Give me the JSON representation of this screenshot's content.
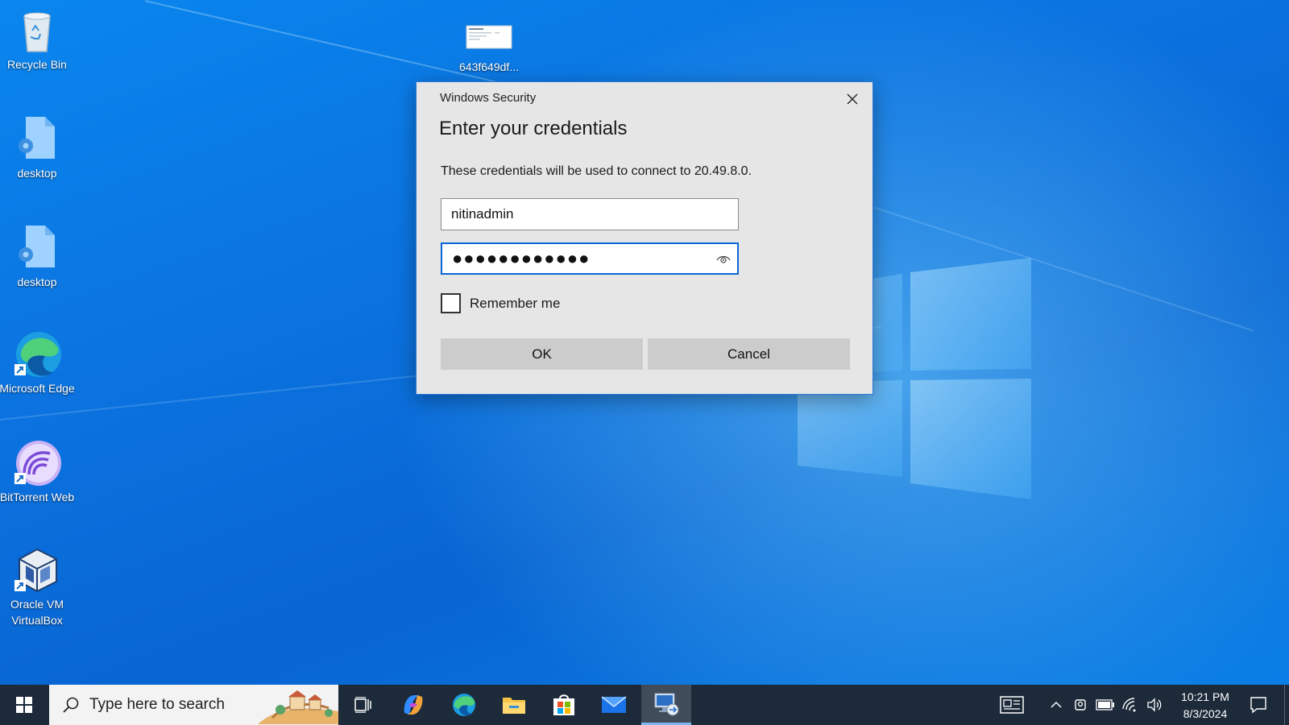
{
  "desktop": {
    "icons": [
      {
        "label": "Recycle Bin"
      },
      {
        "label": "643f649df..."
      },
      {
        "label": "desktop"
      },
      {
        "label": "desktop"
      },
      {
        "label": "Microsoft Edge"
      },
      {
        "label": "BitTorrent Web"
      },
      {
        "label": "Oracle VM VirtualBox"
      }
    ]
  },
  "dialog": {
    "window_title": "Windows Security",
    "heading": "Enter your credentials",
    "message": "These credentials will be used to connect to 20.49.8.0.",
    "username_value": "nitinadmin",
    "password_mask": "●●●●●●●●●●●●",
    "remember_label": "Remember me",
    "remember_checked": false,
    "ok_label": "OK",
    "cancel_label": "Cancel"
  },
  "taskbar": {
    "search_placeholder": "Type here to search",
    "time": "10:21 PM",
    "date": "8/3/2024",
    "pinned": [
      "task-view-icon",
      "copilot-icon",
      "edge-icon",
      "file-explorer-icon",
      "store-icon",
      "mail-icon",
      "remote-desktop-icon"
    ]
  },
  "colors": {
    "desktop_blue": "#0a7fe6",
    "dialog_bg": "#e6e6e6",
    "focus_border": "#0a66d6",
    "taskbar_bg": "#1c2a3a"
  }
}
